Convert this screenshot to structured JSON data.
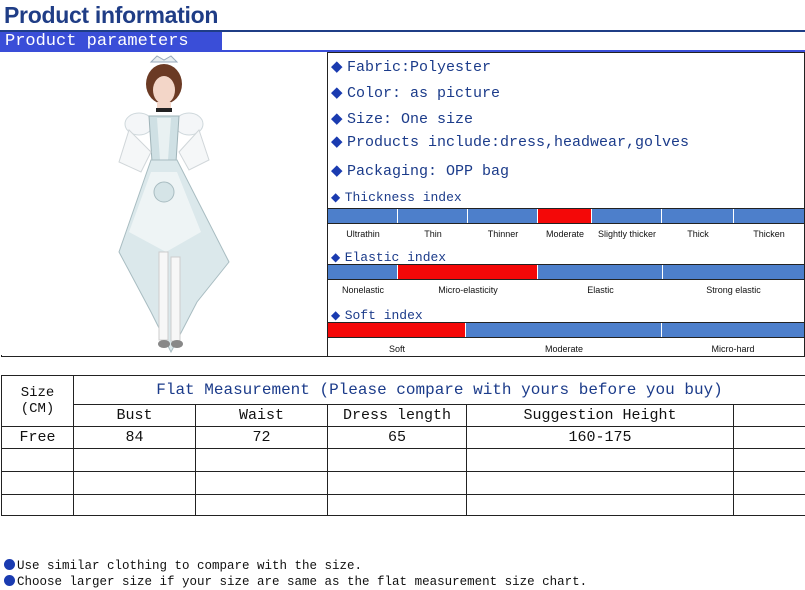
{
  "header": {
    "title": "Product information",
    "section": "Product parameters"
  },
  "colors": {
    "accent": "#3a4ed8",
    "scale_blue": "#4d7fcb",
    "scale_red": "#f40808"
  },
  "specs": [
    {
      "icon": "diamond-icon",
      "label": "Fabric:Polyester"
    },
    {
      "icon": "diamond-icon",
      "label": "Color: as picture"
    },
    {
      "icon": "diamond-icon",
      "label": "Size: One size"
    },
    {
      "icon": "diamond-icon",
      "label": "Products include:dress,headwear,golves"
    },
    {
      "icon": "diamond-icon",
      "label": "Packaging: OPP bag"
    }
  ],
  "thickness": {
    "label": "Thickness index",
    "levels": [
      "Ultrathin",
      "Thin",
      "Thinner",
      "Moderate",
      "Slightly thicker",
      "Thick",
      "Thicken"
    ],
    "selected": "Moderate"
  },
  "elastic": {
    "label": "Elastic index",
    "levels": [
      "Nonelastic",
      "Micro-elasticity",
      "Elastic",
      "Strong elastic"
    ],
    "selected": "Micro-elasticity"
  },
  "soft": {
    "label": "Soft index",
    "levels": [
      "Soft",
      "Moderate",
      "Micro-hard"
    ],
    "selected": "Soft"
  },
  "size_table": {
    "size_header": "Size (CM)",
    "title": "Flat Measurement (Please compare with yours before you buy)",
    "columns": [
      "Bust",
      "Waist",
      "Dress length",
      "Suggestion Height"
    ],
    "rows": [
      {
        "size": "Free",
        "values": [
          "84",
          "72",
          "65",
          "160-175"
        ]
      }
    ]
  },
  "notes": [
    "Use similar clothing to compare with the size.",
    "Choose larger size if your size are same as the flat measurement size chart."
  ]
}
